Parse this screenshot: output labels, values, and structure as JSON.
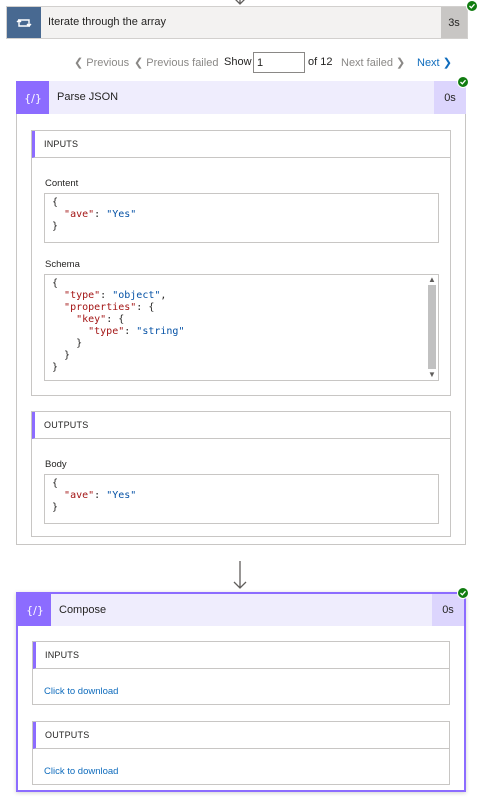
{
  "loop": {
    "title": "Iterate through the array",
    "duration": "3s",
    "icon": "loop-icon"
  },
  "pager": {
    "previous": "Previous",
    "previous_failed": "Previous failed",
    "show_label": "Show",
    "show_value": "1",
    "of_label": "of 12",
    "next_failed": "Next failed",
    "next": "Next"
  },
  "parse_json": {
    "title": "Parse JSON",
    "duration": "0s",
    "icon": "braces-icon",
    "inputs_label": "INPUTS",
    "content_label": "Content",
    "content_lines": [
      "{",
      "  \"ave\": \"Yes\"",
      "}"
    ],
    "schema_label": "Schema",
    "schema_lines": [
      "{",
      "  \"type\": \"object\",",
      "  \"properties\": {",
      "    \"key\": {",
      "      \"type\": \"string\"",
      "    }",
      "  }",
      "}"
    ],
    "outputs_label": "OUTPUTS",
    "body_label": "Body",
    "body_lines": [
      "{",
      "  \"ave\": \"Yes\"",
      "}"
    ]
  },
  "compose": {
    "title": "Compose",
    "duration": "0s",
    "icon": "braces-icon",
    "inputs_label": "INPUTS",
    "inputs_link": "Click to download",
    "outputs_label": "OUTPUTS",
    "outputs_link": "Click to download"
  },
  "colors": {
    "loop_accent": "#486991",
    "action_accent": "#8c6cff",
    "success": "#107c10",
    "link": "#0f6cbd"
  }
}
